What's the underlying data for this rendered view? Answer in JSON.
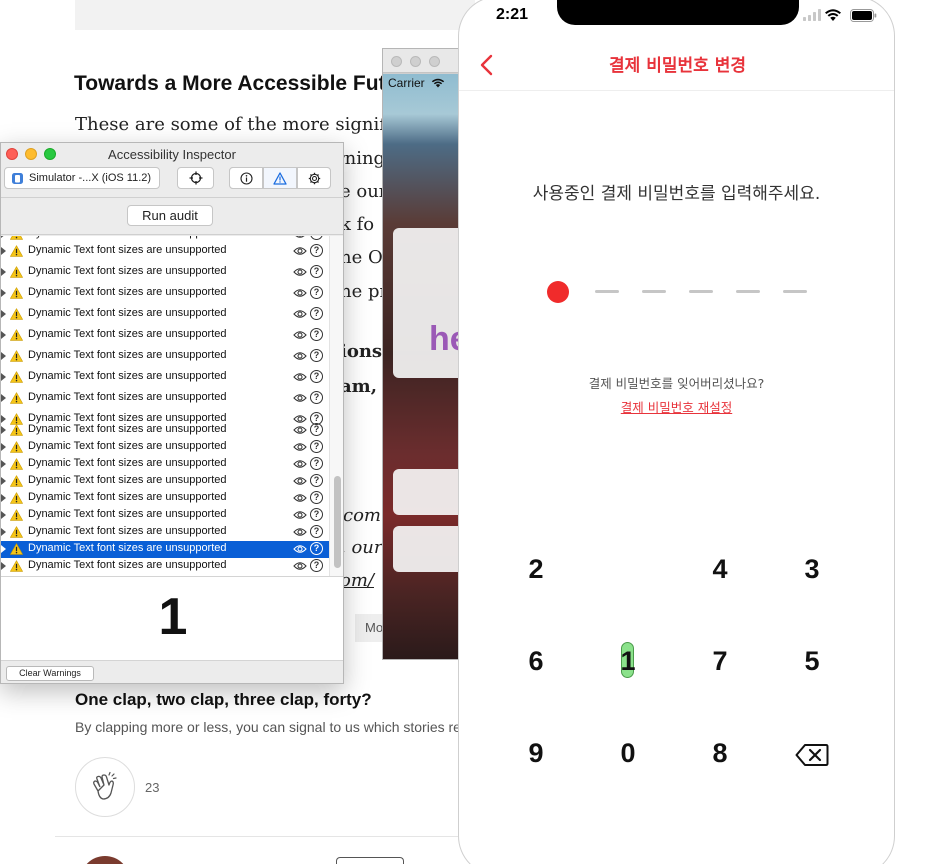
{
  "article": {
    "heading": "Towards a More Accessible Fut",
    "lines": [
      "These are some of the more signifi",
      "rning",
      "e our",
      "k fo",
      "he O",
      "ne pr",
      "ions",
      "am, p",
      "comi",
      ", our",
      "om/"
    ],
    "more_label": "Mo",
    "clap_title": "One clap, two clap, three clap, forty?",
    "clap_desc": "By clapping more or less, you can signal to us which stories re",
    "clap_count": "23"
  },
  "simulator": {
    "carrier": "Carrier",
    "hello_fragment": "he"
  },
  "inspector": {
    "title": "Accessibility Inspector",
    "target_label": "Simulator -...X (iOS 11.2)",
    "run_audit_label": "Run audit",
    "clear_warnings_label": "Clear Warnings",
    "warning_count": "1",
    "warning_text": "Dynamic Text font sizes are unsupported",
    "selected_index": 17
  },
  "phone": {
    "time": "2:21",
    "nav_title": "결제 비밀번호 변경",
    "prompt": "사용중인 결제 비밀번호를 입력해주세요.",
    "pin_length": 6,
    "pin_filled": 1,
    "forgot_text": "결제 비밀번호를 잊어버리셨나요?",
    "reset_link": "결제 비밀번호 재설정",
    "keypad": {
      "row1": [
        "2",
        "",
        "4",
        "3"
      ],
      "row2": [
        "6",
        "1",
        "7",
        "5"
      ],
      "row3": [
        "9",
        "0",
        "8"
      ]
    },
    "accent_color": "#e8333b"
  }
}
